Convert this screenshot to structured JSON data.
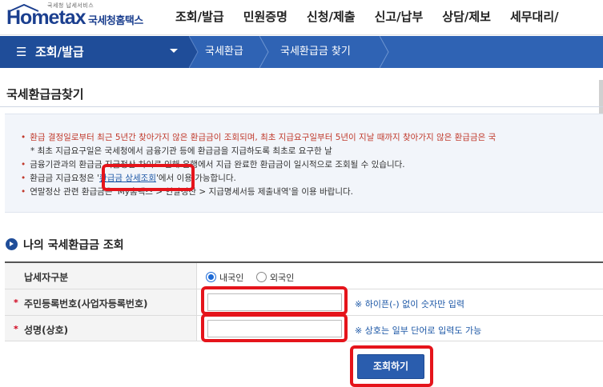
{
  "header": {
    "logo_small": "국세청 납세서비스",
    "logo_main": "Hometax",
    "logo_kr": "국세청홈택스",
    "nav": [
      "조회/발급",
      "민원증명",
      "신청/제출",
      "신고/납부",
      "상담/제보",
      "세무대리/"
    ]
  },
  "location": {
    "main": "조회/발급",
    "crumbs": [
      "국세환급",
      "국세환급금 찾기"
    ]
  },
  "page": {
    "title": "국세환급금찾기"
  },
  "notices": {
    "n1": "환급 결정일로부터 최근 5년간 찾아가지 않은 환급금이 조회되며, 최초 지급요구일부터 5년이 지날 때까지 찾아가지 않은 환급금은 국",
    "n1_sub": "* 최초 지급요구일은 국세청에서 금융기관 등에 환급금을 지급하도록 최초로 요구한 날",
    "n2": "금융기관과의 환급금 지급정산 차이로 인해 은행에서 지급 완료한 환급금이 일시적으로 조회될 수 있습니다.",
    "n3_before": "환급금 지급요청은 '",
    "n3_link": "환급금 상세조회",
    "n3_after": "'에서 이용 가능합니다.",
    "n4": "연말정산 관련 환급금은 'My홈택스 > 연말정산 > 지급명세서등 제출내역'을 이용 바랍니다."
  },
  "section": {
    "title": "나의 국세환급금 조회"
  },
  "form": {
    "taxpayer_type_label": "납세자구분",
    "taxpayer_options": [
      "내국인",
      "외국인"
    ],
    "selected_option": "내국인",
    "id_label": "주민등록번호(사업자등록번호)",
    "id_value": "",
    "id_hint": "※ 하이픈(-) 없이 숫자만 입력",
    "name_label": "성명(상호)",
    "name_value": "",
    "name_hint": "※ 상호는 일부 단어로 입력도 가능",
    "required_mark": "*"
  },
  "submit_label": "조회하기",
  "colors": {
    "brand": "#1f4d99",
    "accent_bar": "#2f63b4",
    "highlight": "#e5141b",
    "notice_red": "#c0392b"
  },
  "icons": {
    "menu": "hamburger-icon",
    "dropdown": "caret-down-icon",
    "section": "circle-arrow-icon"
  }
}
